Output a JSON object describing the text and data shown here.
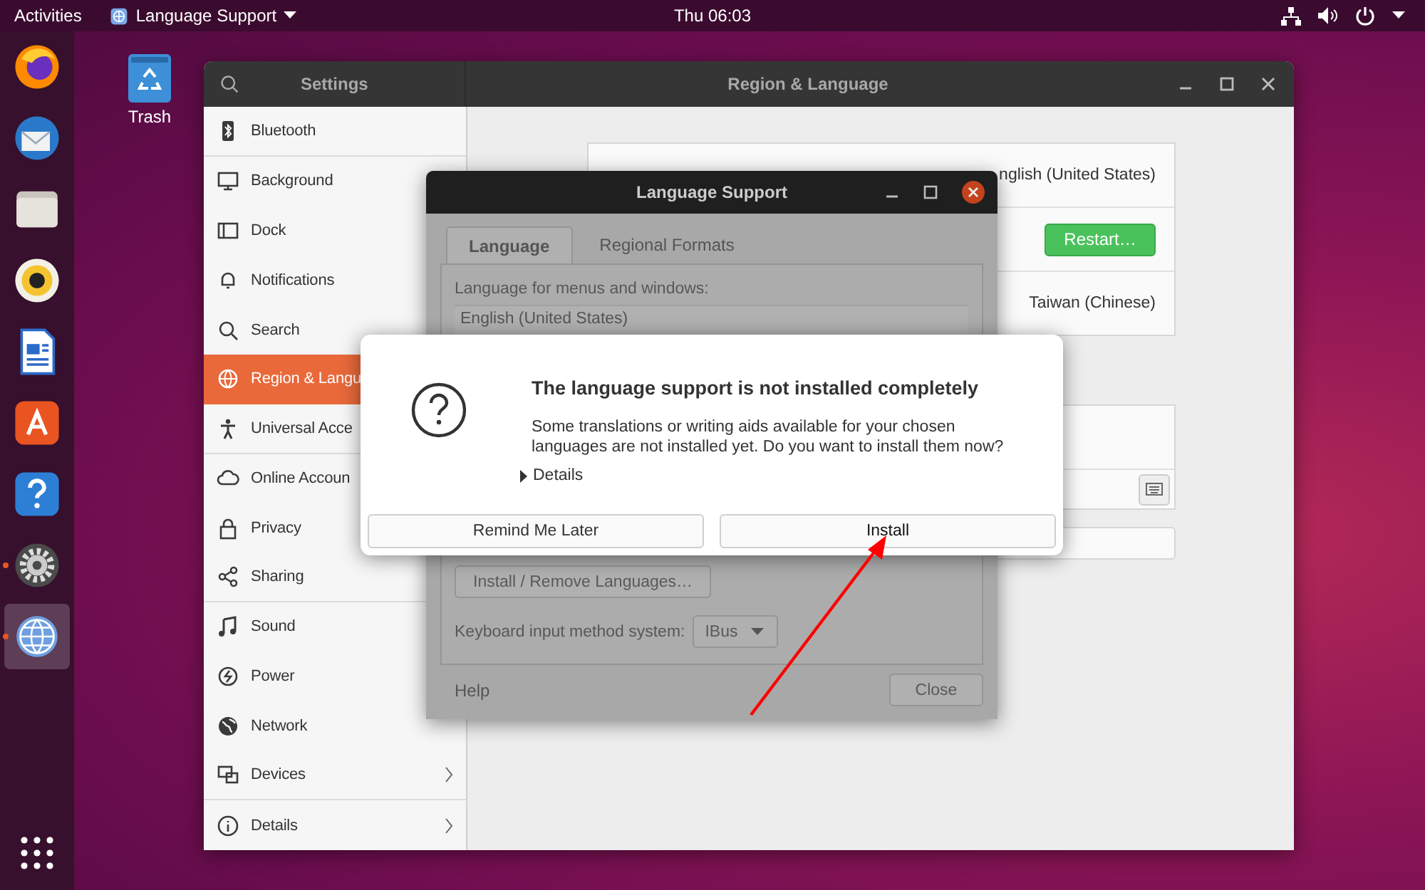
{
  "top_bar": {
    "activities": "Activities",
    "app_menu": "Language Support",
    "clock": "Thu 06:03"
  },
  "dock": [
    {
      "kind": "browser",
      "running": false,
      "selected": false
    },
    {
      "kind": "mail",
      "running": false,
      "selected": false
    },
    {
      "kind": "files",
      "running": false,
      "selected": false
    },
    {
      "kind": "music",
      "running": false,
      "selected": false
    },
    {
      "kind": "writer",
      "running": false,
      "selected": false
    },
    {
      "kind": "store",
      "running": false,
      "selected": false
    },
    {
      "kind": "help",
      "running": false,
      "selected": false
    },
    {
      "kind": "settings",
      "running": true,
      "selected": false
    },
    {
      "kind": "language",
      "running": true,
      "selected": true
    }
  ],
  "desktop_icons": [
    {
      "label": "Trash"
    }
  ],
  "settings": {
    "panel_title": "Settings",
    "title": "Region & Language",
    "sidebar": [
      {
        "label": "Bluetooth",
        "kind": "bluetooth",
        "selected": false,
        "chevron": false,
        "group_end": true
      },
      {
        "label": "Background",
        "kind": "background",
        "selected": false,
        "chevron": false,
        "group_end": false
      },
      {
        "label": "Dock",
        "kind": "dock",
        "selected": false,
        "chevron": false,
        "group_end": false
      },
      {
        "label": "Notifications",
        "kind": "notifications",
        "selected": false,
        "chevron": false,
        "group_end": false
      },
      {
        "label": "Search",
        "kind": "search",
        "selected": false,
        "chevron": false,
        "group_end": false
      },
      {
        "label": "Region & Langu",
        "kind": "region",
        "selected": true,
        "chevron": false,
        "group_end": false
      },
      {
        "label": "Universal Acce",
        "kind": "access",
        "selected": false,
        "chevron": false,
        "group_end": true
      },
      {
        "label": "Online Accoun",
        "kind": "online",
        "selected": false,
        "chevron": false,
        "group_end": false
      },
      {
        "label": "Privacy",
        "kind": "privacy",
        "selected": false,
        "chevron": false,
        "group_end": false
      },
      {
        "label": "Sharing",
        "kind": "sharing",
        "selected": false,
        "chevron": false,
        "group_end": true
      },
      {
        "label": "Sound",
        "kind": "sound",
        "selected": false,
        "chevron": false,
        "group_end": false
      },
      {
        "label": "Power",
        "kind": "power",
        "selected": false,
        "chevron": false,
        "group_end": false
      },
      {
        "label": "Network",
        "kind": "network",
        "selected": false,
        "chevron": false,
        "group_end": false
      },
      {
        "label": "Devices",
        "kind": "devices",
        "selected": false,
        "chevron": true,
        "group_end": true
      },
      {
        "label": "Details",
        "kind": "details",
        "selected": false,
        "chevron": true,
        "group_end": false
      }
    ],
    "rows": [
      {
        "kind": "value",
        "text": "nglish (United States)"
      },
      {
        "kind": "button",
        "text": "Restart…"
      },
      {
        "kind": "value",
        "text": "Taiwan (Chinese)"
      }
    ]
  },
  "language_support": {
    "title": "Language Support",
    "tabs": [
      {
        "label": "Language",
        "selected": true
      },
      {
        "label": "Regional Formats",
        "selected": false
      }
    ],
    "menu_label": "Language for menus and windows:",
    "languages": [
      "English (United States)"
    ],
    "install_button": "Install / Remove Languages…",
    "im_label": "Keyboard input method system:",
    "im_value": "IBus",
    "help": "Help",
    "close": "Close"
  },
  "dialog": {
    "title": "The language support is not installed completely",
    "message": "Some translations or writing aids available for your chosen languages are not installed yet. Do you want to install them now?",
    "details": "Details",
    "expanded": false,
    "buttons": [
      {
        "label": "Remind Me Later",
        "kind": "normal"
      },
      {
        "label": "Install",
        "kind": "default"
      }
    ]
  }
}
